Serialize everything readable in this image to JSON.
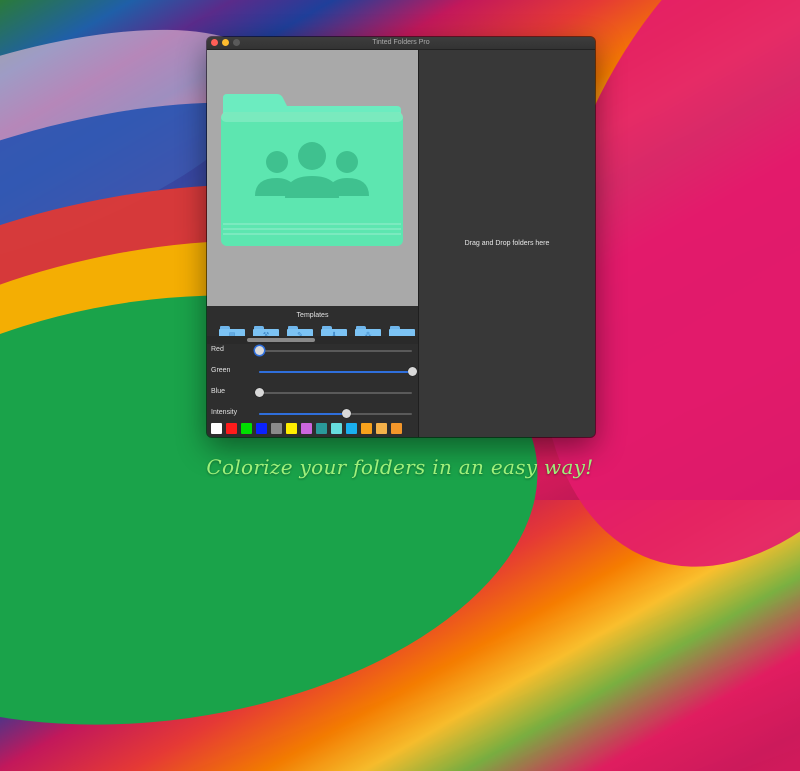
{
  "window": {
    "title": "Tinted Folders Pro"
  },
  "preview": {
    "folder_color": "#5de6b0",
    "folder_tab_color": "#6cecc0",
    "icon": "people-group-icon"
  },
  "templates": {
    "label": "Templates",
    "items": [
      {
        "icon": "calendar-icon",
        "glyph": "▤"
      },
      {
        "icon": "hammer-icon",
        "glyph": "⚒"
      },
      {
        "icon": "pencil-icon",
        "glyph": "✎"
      },
      {
        "icon": "download-icon",
        "glyph": "⬇"
      },
      {
        "icon": "people-icon",
        "glyph": "⁂"
      },
      {
        "icon": "folder-icon",
        "glyph": ""
      }
    ]
  },
  "sliders": [
    {
      "label": "Red",
      "value": 0.0
    },
    {
      "label": "Green",
      "value": 1.0
    },
    {
      "label": "Blue",
      "value": 0.0
    },
    {
      "label": "Intensity",
      "value": 0.57
    }
  ],
  "swatches": [
    "#ffffff",
    "#ff1b1b",
    "#00e000",
    "#0b22ff",
    "#8a8a8a",
    "#ffee00",
    "#cc66dd",
    "#2a9a9a",
    "#66dddd",
    "#1ab0f0",
    "#f7a21c",
    "#f5b24a",
    "#f2962a"
  ],
  "drop_zone": {
    "text": "Drag and Drop folders here"
  },
  "tagline": "Colorize your folders in an easy way!",
  "colors": {
    "accent": "#2f6fdc",
    "tagline": "#9ff07a"
  }
}
